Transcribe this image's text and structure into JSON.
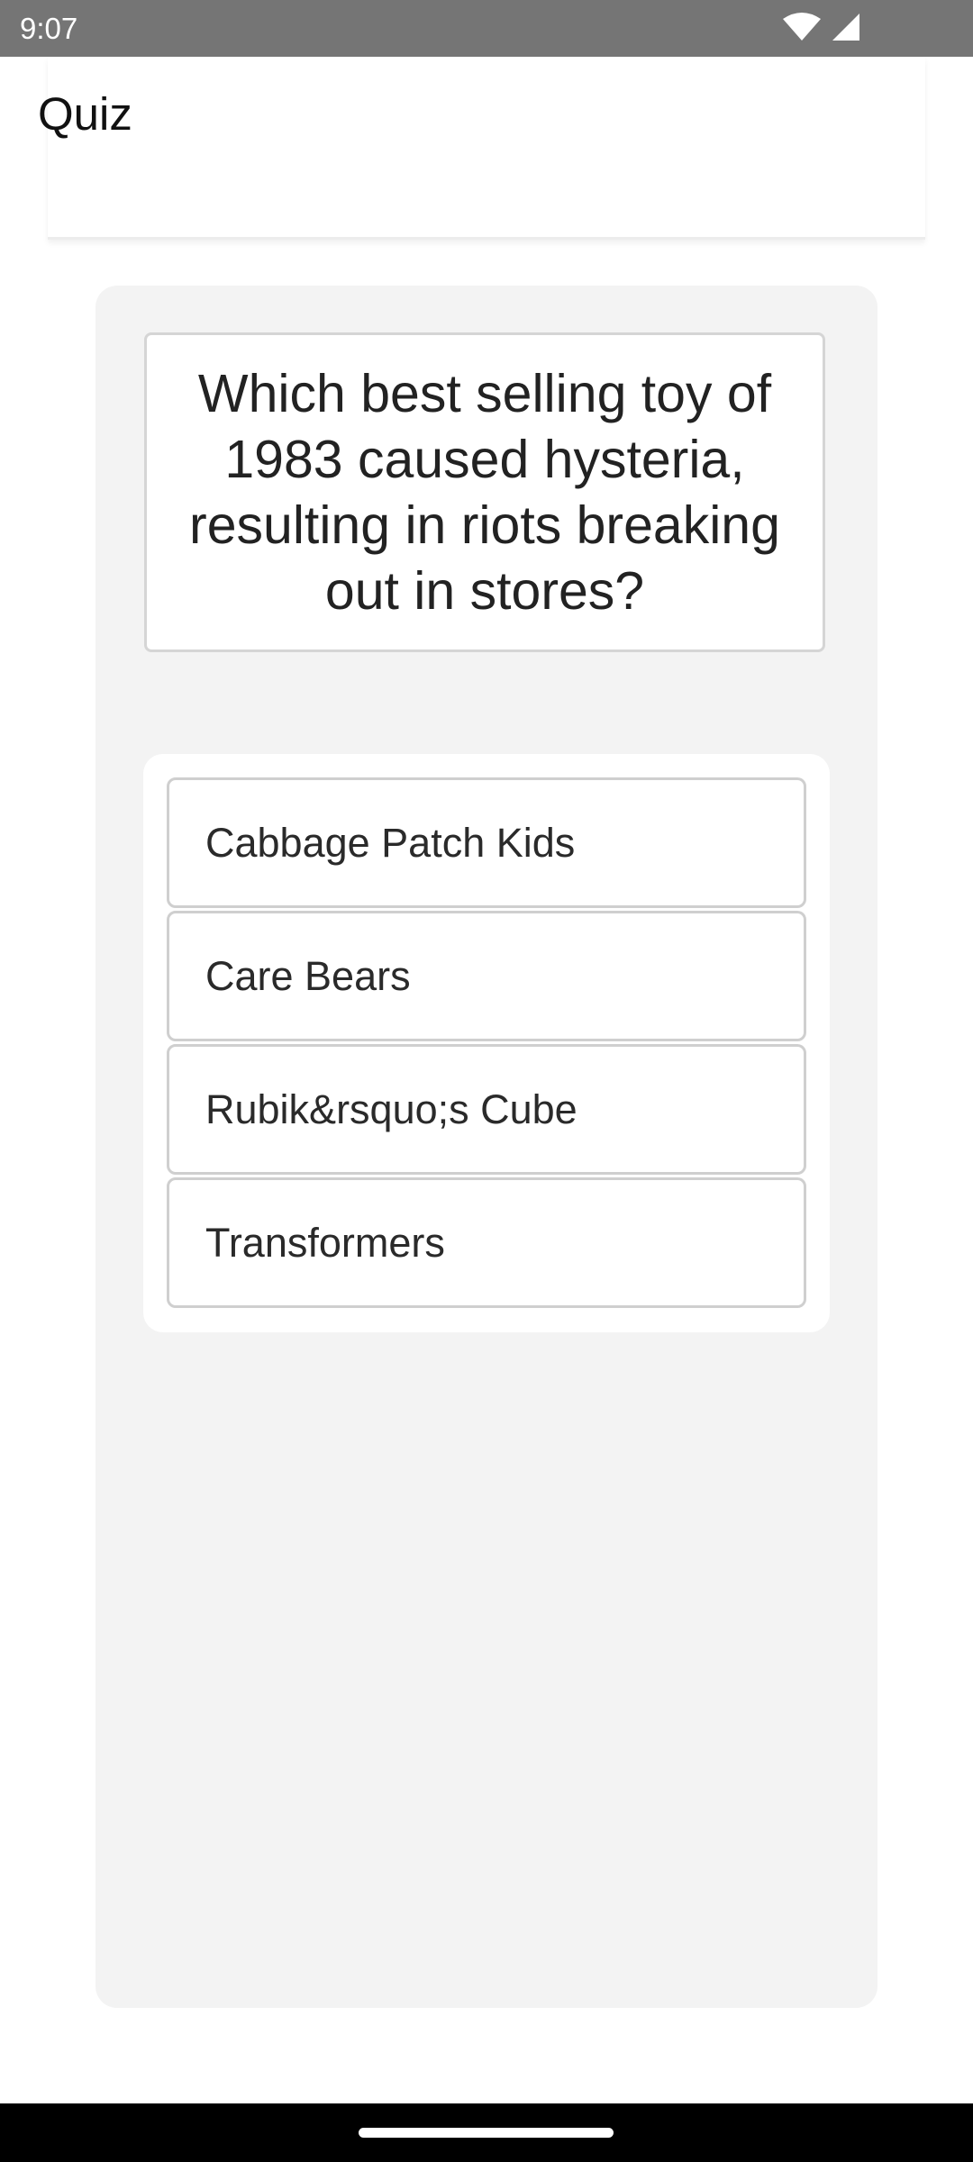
{
  "status_bar": {
    "time": "9:07",
    "icons": [
      "wifi-icon",
      "signal-icon"
    ]
  },
  "header": {
    "title": "Quiz"
  },
  "quiz": {
    "question": "Which best selling toy of 1983 caused hysteria, resulting in riots breaking out in stores?",
    "options": [
      {
        "label": "Cabbage Patch Kids"
      },
      {
        "label": "Care Bears"
      },
      {
        "label": "Rubik&rsquo;s Cube"
      },
      {
        "label": "Transformers"
      }
    ]
  },
  "colors": {
    "status_bar_bg": "#757575",
    "panel_bg": "#f3f3f3",
    "card_border": "#d5d5d5",
    "nav_bar_bg": "#000000"
  }
}
